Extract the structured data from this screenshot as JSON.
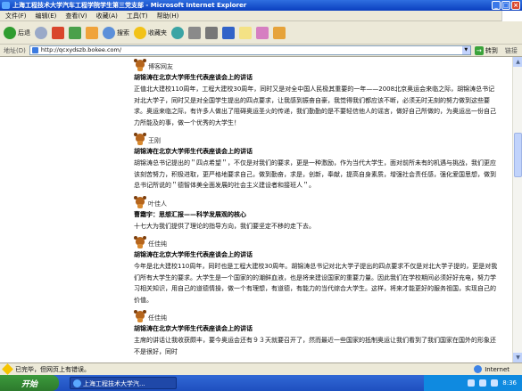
{
  "window": {
    "title": "上海工程技术大学汽车工程学院学生第三党支部 - Microsoft Internet Explorer",
    "buttons": [
      "_",
      "□",
      "×"
    ]
  },
  "menu": [
    "文件(F)",
    "编辑(E)",
    "查看(V)",
    "收藏(A)",
    "工具(T)",
    "帮助(H)"
  ],
  "toolbar": {
    "back": "后退",
    "search": "搜索",
    "favorites": "收藏夹"
  },
  "address": {
    "label": "地址(D)",
    "url": "http://qcxydszb.bokee.com/",
    "go": "转到",
    "links": "链接"
  },
  "posts": [
    {
      "author": "博客网友",
      "title": "胡锦涛在北京大学师生代表座谈会上的讲话",
      "body": "正值北大建校110周年，工程大建校30周年，同时又是对全中国人民极其重要的一年——2008北京奥运会来临之际，胡锦涛总书记对北大学子，同时又是对全国学生提出的四点要求，让我感到振奋自豪，我觉得我们都应该不断，必须无时无刻的努力做到这些要求。奥运来临之际，有许多人做出了阻碍奥运圣火的传递，我们勤勤的是不要轻信他人的谣言，做好自己所做的，为奥运出一份自己力所能及的事，做一个优秀的大学生！"
    },
    {
      "author": "王刚",
      "title": "胡锦涛在北京大学师生代表座谈会上的讲话",
      "body": "胡锦涛总书记提出的＂四点希望＂，不仅是对我们的要求，更是一种激励，作为当代大学生，面对前所未有的机遇与挑战，我们更应该刻苦努力，积极进取，更严格地要求自己，做到勤奋，求是，创新，奉献，提高自身素质，增强社会责任感，强化爱国思想，做到总书记所说的＂德智体美全面发展的社会主义建设者和接班人＂。"
    },
    {
      "author": "叶佳人",
      "title": "曹霜宇：思想汇报——科学发展观的核心",
      "body": "十七大为我们提供了理论的指导方向，我们要坚定不移的走下去。"
    },
    {
      "author": "任佳纯",
      "title": "胡锦涛在北京大学师生代表座谈会上的讲话",
      "body": "今年是北大建校110周年，同时也是工程大建校30周年。胡锦涛总书记对北大学子提出的四点要求不仅是对北大学子提的，更是对我们所有大学生的要求。大学生是一个国家的的潮鲜血液，也是将来建设国家的重要力量。因此我们在学校期间必须好好充电，努力学习相关知识，用自己的道德情操，做一个有理想，有道德，有能力的当代综合大学生。这样，将来才能更好的服务祖国，实现自己的价值。"
    },
    {
      "author": "任佳纯",
      "title": "胡锦涛在北京大学师生代表座谈会上的讲话",
      "body": "主席的讲话让我收获颇丰，要今奥运会还有９３天就要召开了，然而最近一些国家的抵制奥运让我们看到了我们国家在国外的形象还不是很好，同时"
    }
  ],
  "status": {
    "text": "已完毕，但网页上有错误。",
    "zone": "Internet"
  },
  "taskbar": {
    "start": "开始",
    "task": "上海工程技术大学汽...",
    "time": "8:36"
  }
}
